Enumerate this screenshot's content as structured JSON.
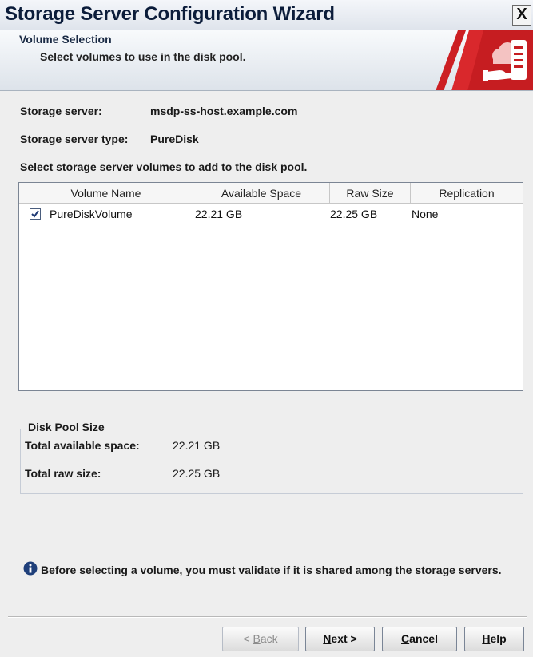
{
  "window": {
    "title": "Storage Server Configuration Wizard",
    "close_glyph": "X"
  },
  "banner": {
    "title": "Volume Selection",
    "subtitle": "Select volumes to use in the disk pool.",
    "logo_icon": "storage-cloud-hand-icon",
    "accent": "#cc1f23"
  },
  "server": {
    "server_label": "Storage server:",
    "server_value": "msdp-ss-host.example.com",
    "type_label": "Storage server type:",
    "type_value": "PureDisk",
    "instruction": "Select storage server volumes to add to the disk pool."
  },
  "volumes": {
    "columns": [
      "Volume Name",
      "Available Space",
      "Raw Size",
      "Replication"
    ],
    "rows": [
      {
        "checked": true,
        "name": "PureDiskVolume",
        "available": "22.21 GB",
        "raw": "22.25 GB",
        "replication": "None"
      }
    ]
  },
  "disk_pool": {
    "title": "Disk Pool Size",
    "total_available_label": "Total available space:",
    "total_available_value": "22.21 GB",
    "total_raw_label": "Total raw size:",
    "total_raw_value": "22.25 GB"
  },
  "message": {
    "icon": "info-icon",
    "text": "Before selecting a volume, you must validate if it is shared among the storage servers."
  },
  "buttons": {
    "back": {
      "prefix": "< ",
      "mnemonic": "B",
      "rest": "ack",
      "enabled": false
    },
    "next": {
      "prefix": "",
      "mnemonic": "N",
      "rest": "ext >",
      "enabled": true
    },
    "cancel": {
      "prefix": "",
      "mnemonic": "C",
      "rest": "ancel",
      "enabled": true
    },
    "help": {
      "prefix": "",
      "mnemonic": "H",
      "rest": "elp",
      "enabled": true
    }
  }
}
